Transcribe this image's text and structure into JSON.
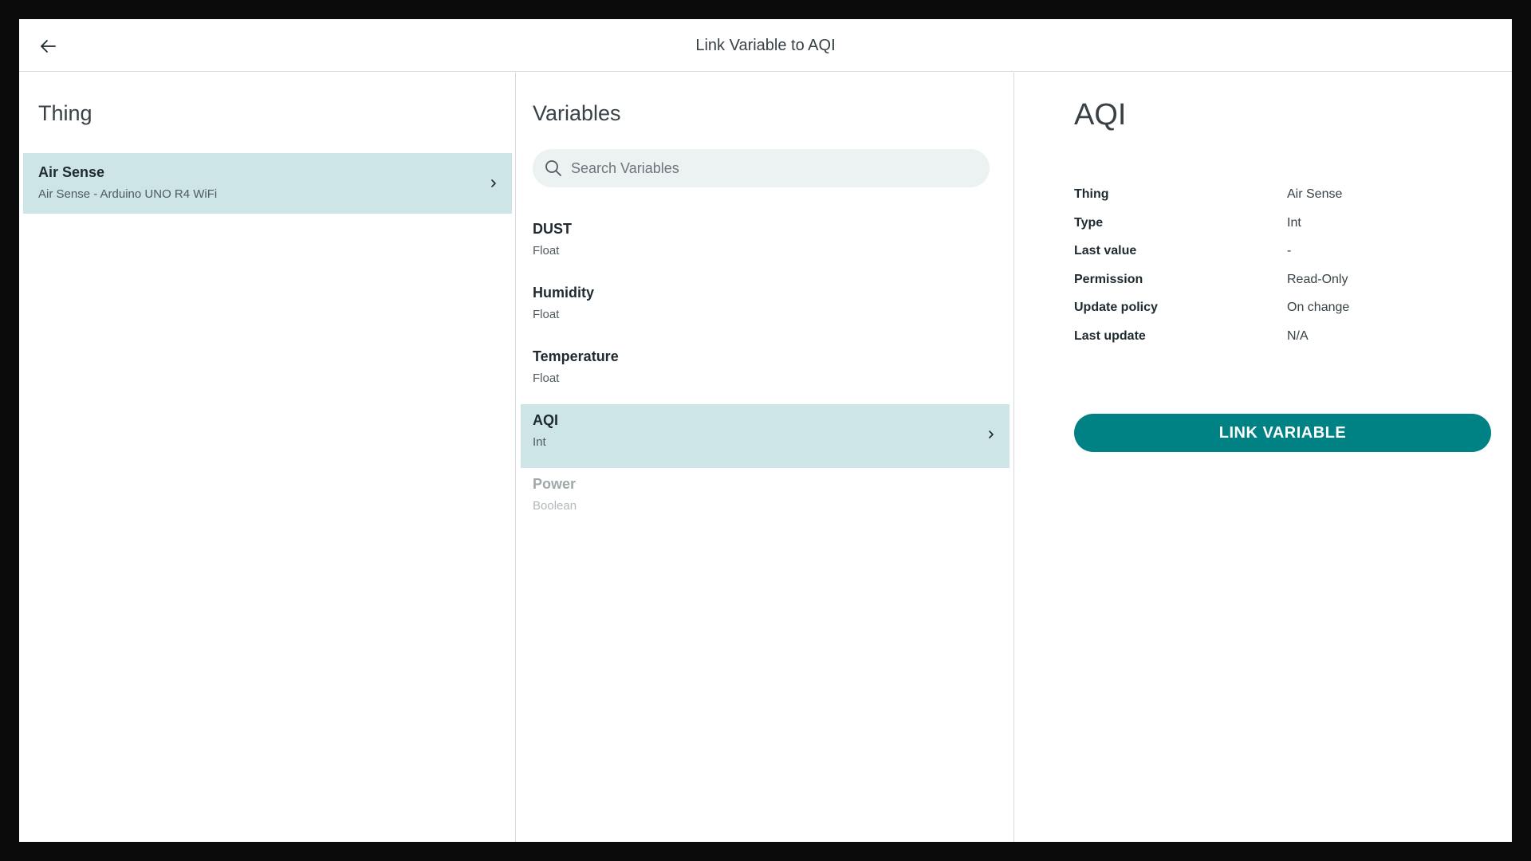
{
  "header": {
    "title": "Link Variable to AQI"
  },
  "thing_panel": {
    "heading": "Thing",
    "item": {
      "title": "Air Sense",
      "subtitle": "Air Sense - Arduino UNO R4 WiFi"
    }
  },
  "variables_panel": {
    "heading": "Variables",
    "search_placeholder": "Search Variables",
    "items": [
      {
        "name": "DUST",
        "type": "Float"
      },
      {
        "name": "Humidity",
        "type": "Float"
      },
      {
        "name": "Temperature",
        "type": "Float"
      },
      {
        "name": "AQI",
        "type": "Int"
      },
      {
        "name": "Power",
        "type": "Boolean"
      }
    ]
  },
  "detail_panel": {
    "heading": "AQI",
    "properties": [
      {
        "label": "Thing",
        "value": "Air Sense"
      },
      {
        "label": "Type",
        "value": "Int"
      },
      {
        "label": "Last value",
        "value": "-"
      },
      {
        "label": "Permission",
        "value": "Read-Only"
      },
      {
        "label": "Update policy",
        "value": "On change"
      },
      {
        "label": "Last update",
        "value": "N/A"
      }
    ],
    "link_button_label": "LINK VARIABLE"
  },
  "colors": {
    "accent": "#008184",
    "selected_bg": "#cde5e6"
  }
}
